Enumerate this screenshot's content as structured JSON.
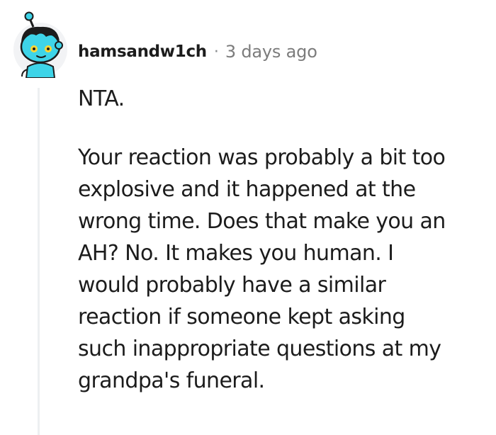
{
  "comment": {
    "author": "hamsandw1ch",
    "separator": "·",
    "timestamp": "3 days ago",
    "avatar_icon": "snoo-avatar-icon",
    "colors": {
      "avatar_skin": "#3ed4e8",
      "avatar_hair": "#1c1c1c",
      "avatar_eyes": "#ffd635",
      "avatar_bg": "#f2f3f5",
      "thread_line": "#edeff1",
      "text": "#1c1c1c",
      "meta_text": "#7c7c7c"
    },
    "body": {
      "paragraph_1": [
        "NTA."
      ],
      "paragraph_2": [
        "Your reaction was probably a bit too",
        "explosive and it happened at the",
        "wrong time. Does that make you an",
        "AH? No. It makes you human. I",
        "would probably have a similar",
        "reaction if someone kept asking",
        "such inappropriate questions at my",
        "grandpa's funeral."
      ]
    }
  }
}
